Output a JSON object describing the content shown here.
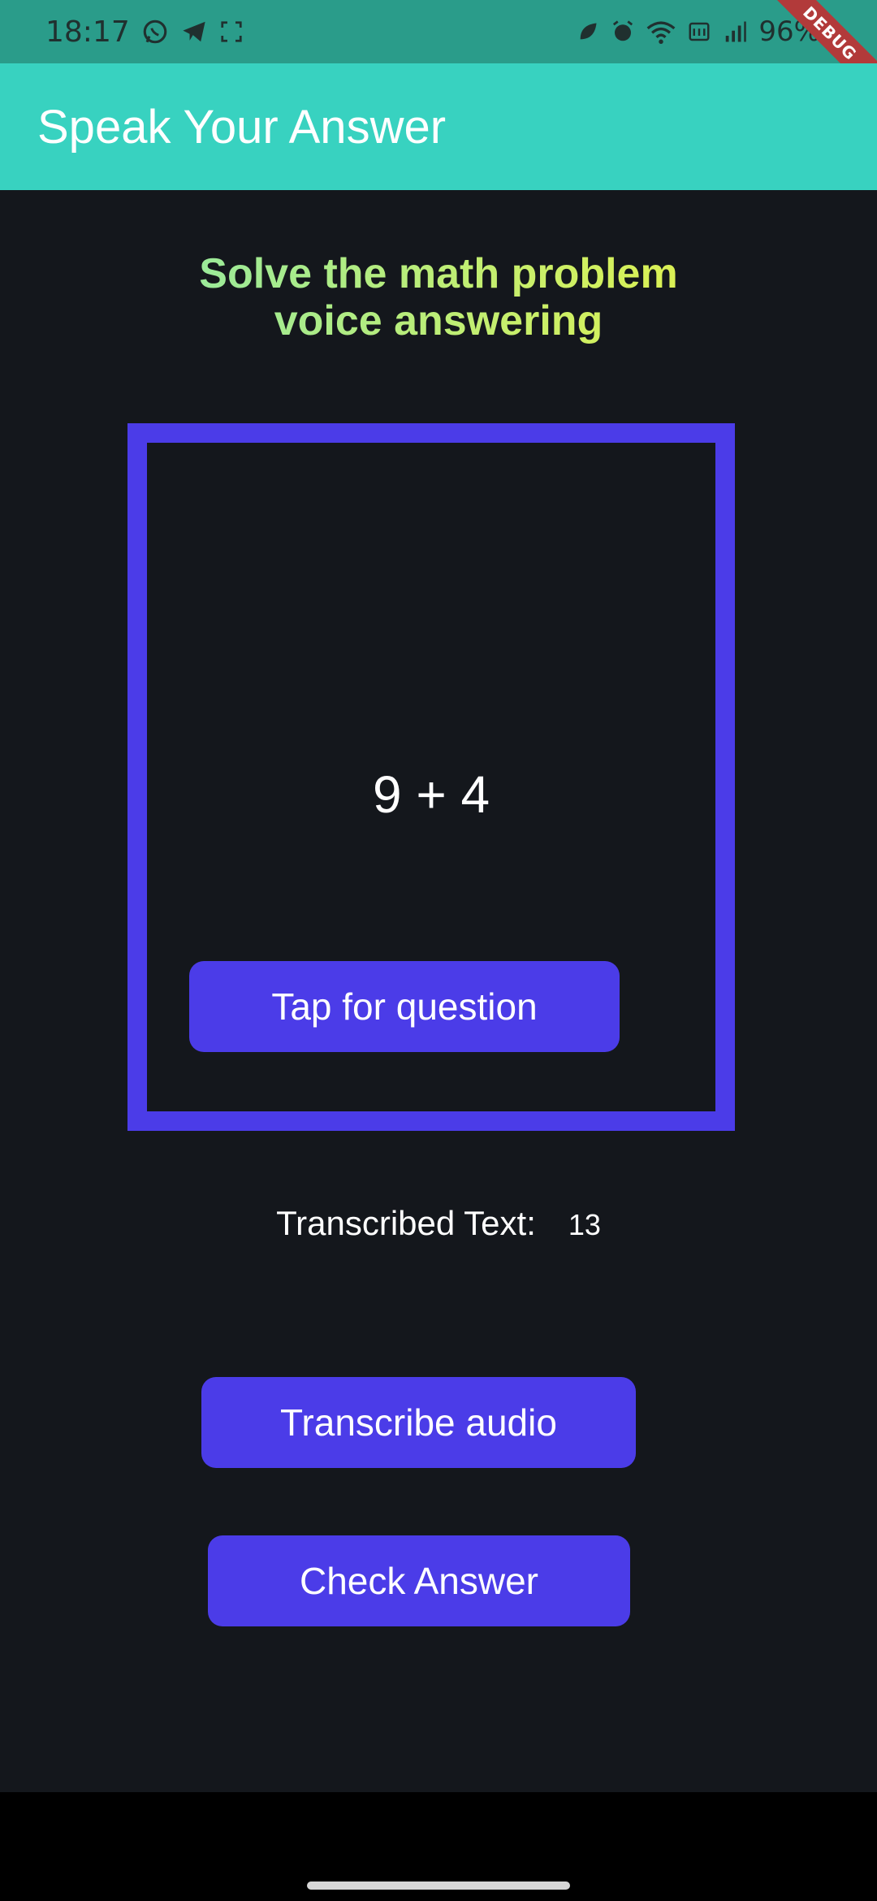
{
  "status_bar": {
    "time": "18:17",
    "battery": "96%",
    "left_icons": [
      "whatsapp-icon",
      "telegram-icon",
      "screenshot-icon"
    ],
    "right_icons": [
      "leaf-icon",
      "alarm-icon",
      "wifi-icon",
      "volte-icon",
      "signal-icon"
    ],
    "debug_banner": "DEBUG"
  },
  "app_bar": {
    "title": "Speak Your Answer",
    "color": "#38d2c0"
  },
  "headline": {
    "line1": "Solve the math problem",
    "line2": "voice answering"
  },
  "card": {
    "problem": "9 + 4",
    "button_label": "Tap for question",
    "border_color": "#4b3ce8"
  },
  "transcription": {
    "label": "Transcribed Text:",
    "value": "13"
  },
  "actions": {
    "transcribe_label": "Transcribe audio",
    "check_label": "Check Answer",
    "button_color": "#4b3ce8"
  }
}
